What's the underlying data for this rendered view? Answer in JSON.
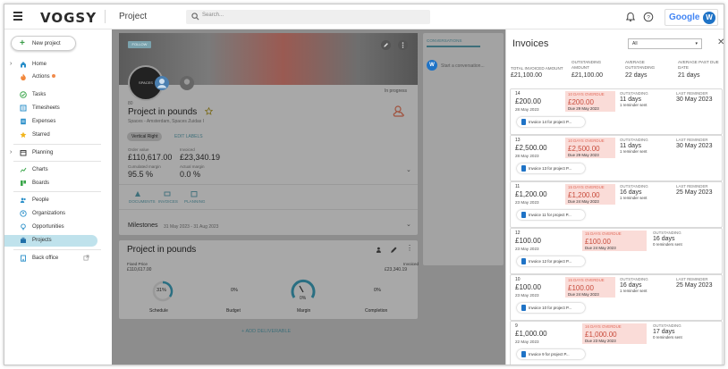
{
  "topbar": {
    "logo": "VOGSY",
    "page_title": "Project",
    "search_placeholder": "Search...",
    "google_label": "Google",
    "avatar_initial": "W"
  },
  "sidebar": {
    "new_project": "New project",
    "items": [
      {
        "label": "Home",
        "icon": "home-icon"
      },
      {
        "label": "Actions",
        "icon": "fire-icon"
      },
      {
        "label": "Tasks",
        "icon": "check-circle-icon"
      },
      {
        "label": "Timesheets",
        "icon": "timesheet-icon"
      },
      {
        "label": "Expenses",
        "icon": "receipt-icon"
      },
      {
        "label": "Starred",
        "icon": "star-icon"
      },
      {
        "label": "Planning",
        "icon": "calendar-icon"
      },
      {
        "label": "Charts",
        "icon": "chart-icon"
      },
      {
        "label": "Boards",
        "icon": "board-icon"
      },
      {
        "label": "People",
        "icon": "people-icon"
      },
      {
        "label": "Organizations",
        "icon": "organization-icon"
      },
      {
        "label": "Opportunities",
        "icon": "lightbulb-icon"
      },
      {
        "label": "Projects",
        "icon": "briefcase-icon"
      },
      {
        "label": "Back office",
        "icon": "building-icon"
      }
    ]
  },
  "project": {
    "follow": "FOLLOW",
    "logo_text": "SPACES",
    "id": "80",
    "title": "Project in pounds",
    "client": "Spaces - Amsterdam, Spaces Zuidas I",
    "status": "In progress",
    "tag": "Vertical Right",
    "edit_labels": "EDIT LABELS",
    "order_value_label": "Order value",
    "order_value": "£110,617.00",
    "invoiced_label": "Invoiced",
    "invoiced": "£23,340.19",
    "cumulated_margin_label": "Cumulated margin",
    "cumulated_margin": "95.5 %",
    "actual_margin_label": "Actual margin",
    "actual_margin": "0.0 %",
    "tabs": [
      "DOCUMENTS",
      "INVOICES",
      "PLANNING"
    ],
    "milestones_label": "Milestones",
    "milestones_dates": "31 May 2023 - 31 Aug 2023",
    "section_title": "Project in pounds",
    "fixed_price_label": "Fixed Price",
    "fixed_price": "£110,617.00",
    "invoiced_label2": "Invoiced",
    "invoiced2": "£23,340.19",
    "gauges": [
      {
        "label": "Schedule",
        "value": "31%"
      },
      {
        "label": "Budget",
        "value": "0%"
      },
      {
        "label": "Margin",
        "value": "0%"
      },
      {
        "label": "Completion",
        "value": "0%"
      }
    ],
    "add_deliverable": "ADD DELIVERABLE",
    "conversations_tab": "CONVERSATIONS",
    "conversation_placeholder": "Start a conversation..."
  },
  "invoices": {
    "title": "Invoices",
    "filter": "All",
    "summary": [
      {
        "label": "TOTAL INVOICED AMOUNT",
        "value": "£21,100.00"
      },
      {
        "label": "OUTSTANDING AMOUNT",
        "value": "£21,100.00"
      },
      {
        "label": "AVERAGE OUTSTANDING",
        "value": "22 days"
      },
      {
        "label": "AVERAGE PAST DUE DATE",
        "value": "21 days"
      }
    ],
    "items": [
      {
        "num": "14",
        "amount": "£200.00",
        "date": "28 May 2023",
        "overdue": "10 DAYS OVERDUE",
        "overdue_amount": "£200.00",
        "due": "Due 29 May 2023",
        "outstanding_label": "OUTSTANDING",
        "outstanding": "11 days",
        "reminders": "1 reminder sent",
        "last_reminder_label": "LAST REMINDER",
        "last_reminder": "30 May 2023",
        "chip": "Invoice 14 for project P..."
      },
      {
        "num": "13",
        "amount": "£2,500.00",
        "date": "28 May 2023",
        "overdue": "10 DAYS OVERDUE",
        "overdue_amount": "£2,500.00",
        "due": "Due 29 May 2023",
        "outstanding_label": "OUTSTANDING",
        "outstanding": "11 days",
        "reminders": "1 reminder sent",
        "last_reminder_label": "LAST REMINDER",
        "last_reminder": "30 May 2023",
        "chip": "Invoice 13 for project P..."
      },
      {
        "num": "11",
        "amount": "£1,200.00",
        "date": "23 May 2023",
        "overdue": "15 DAYS OVERDUE",
        "overdue_amount": "£1,200.00",
        "due": "Due 24 May 2023",
        "outstanding_label": "OUTSTANDING",
        "outstanding": "16 days",
        "reminders": "1 reminder sent",
        "last_reminder_label": "LAST REMINDER",
        "last_reminder": "25 May 2023",
        "chip": "Invoice 11 for project P..."
      },
      {
        "num": "12",
        "amount": "£100.00",
        "date": "23 May 2023",
        "overdue": "15 DAYS OVERDUE",
        "overdue_amount": "£100.00",
        "due": "Due 24 May 2023",
        "outstanding_label": "OUTSTANDING",
        "outstanding": "16 days",
        "reminders": "0 reminders sent",
        "last_reminder_label": "",
        "last_reminder": "",
        "chip": "Invoice 12 for project P..."
      },
      {
        "num": "10",
        "amount": "£100.00",
        "date": "23 May 2023",
        "overdue": "15 DAYS OVERDUE",
        "overdue_amount": "£100.00",
        "due": "Due 24 May 2023",
        "outstanding_label": "OUTSTANDING",
        "outstanding": "16 days",
        "reminders": "1 reminder sent",
        "last_reminder_label": "LAST REMINDER",
        "last_reminder": "25 May 2023",
        "chip": "Invoice 10 for project P..."
      },
      {
        "num": "9",
        "amount": "£1,000.00",
        "date": "22 May 2023",
        "overdue": "16 DAYS OVERDUE",
        "overdue_amount": "£1,000.00",
        "due": "Due 23 May 2023",
        "outstanding_label": "OUTSTANDING",
        "outstanding": "17 days",
        "reminders": "0 reminders sent",
        "last_reminder_label": "",
        "last_reminder": "",
        "chip": "Invoice 9 for project P..."
      }
    ]
  }
}
